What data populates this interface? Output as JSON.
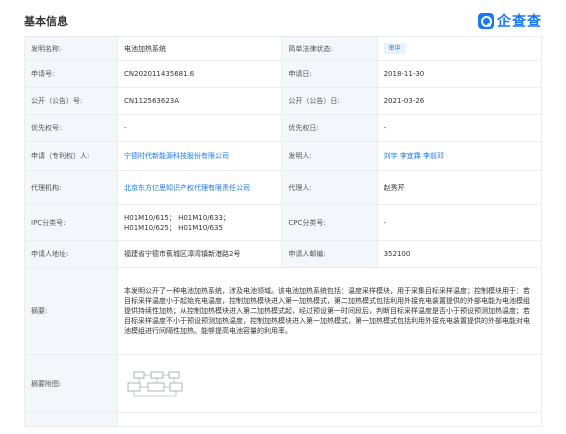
{
  "header": {
    "title": "基本信息",
    "brand": "企查查",
    "brand_icon": "qichacha-logo-icon",
    "brand_color": "#1677ff"
  },
  "rows": {
    "invention_name": {
      "label": "发明名称:",
      "value": "电池加热系统"
    },
    "legal_status": {
      "label": "简单法律状态:",
      "value": "审中"
    },
    "application_no": {
      "label": "申请号:",
      "value": "CN202011435681.6"
    },
    "application_date": {
      "label": "申请日:",
      "value": "2018-11-30"
    },
    "publication_no": {
      "label": "公开（公告）号:",
      "value": "CN112563623A"
    },
    "publication_date": {
      "label": "公开（公告）日:",
      "value": "2021-03-26"
    },
    "priority_no": {
      "label": "优先权号:",
      "value": "-"
    },
    "priority_date": {
      "label": "优先权日:",
      "value": "-"
    },
    "applicant": {
      "label": "申请（专利权）人:",
      "value": "宁德时代新能源科技股份有限公司"
    },
    "inventors": {
      "label": "发明人:",
      "names": [
        "刘宇",
        "李宜霖",
        "李前邓"
      ]
    },
    "agency": {
      "label": "代理机构:",
      "value": "北京东方亿思知识产权代理有限责任公司"
    },
    "agent": {
      "label": "代理人:",
      "value": "赵秀芹"
    },
    "ipc": {
      "label": "IPC分类号:",
      "value": "H01M10/615； H01M10/633； H01M10/625； H01M10/635"
    },
    "cpc": {
      "label": "CPC分类号:",
      "value": "-"
    },
    "applicant_address": {
      "label": "申请人地址:",
      "value": "福建省宁德市蕉城区漳湾镇新港路2号"
    },
    "applicant_postcode": {
      "label": "申请人邮编:",
      "value": "352100"
    },
    "abstract": {
      "label": "摘要:",
      "value": "本发明公开了一种电池加热系统，涉及电池领域。该电池加热系统包括：温度采样模块，用于采集目标采样温度；控制模块用于：若目标采样温度小于起始充电温度，控制加热模块进入第一加热模式，第二加热模式包括利用外接充电装置提供的外部电能为电池模组提供持续性加热；从控制加热模块进入第二加热模式起，经过预设第一时间段后，判断目标采样温度是否小于预设预测加热温度；若目标采样温度不小于预设预测加热温度，控制加热模块进入第一加热模式，第一加热模式包括利用外接充电装置提供的外部电能对电池模组进行间隔性加热。能够提高电池容量的利用率。"
    },
    "abstract_figure": {
      "label": "摘要附图:"
    }
  }
}
